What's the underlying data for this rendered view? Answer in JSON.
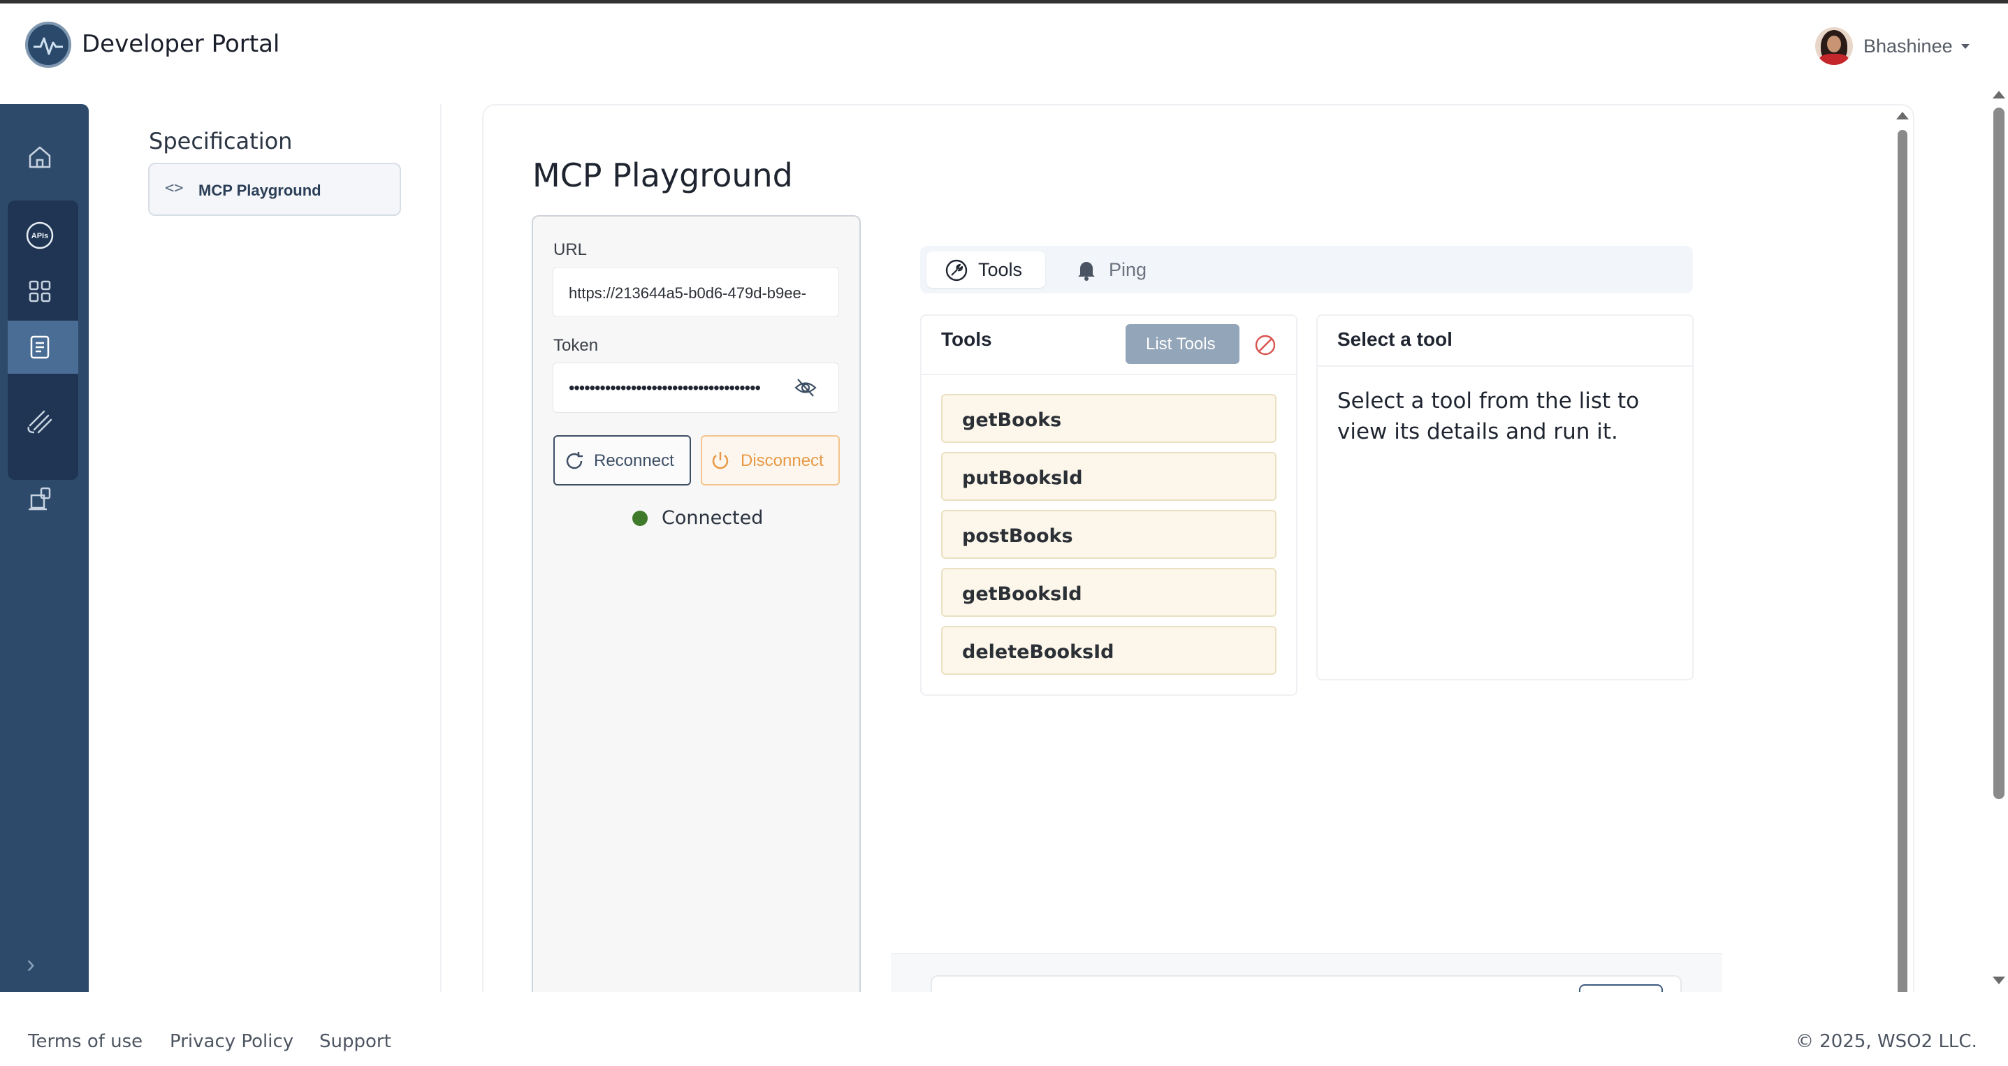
{
  "header": {
    "brand": "Developer Portal",
    "user_name": "Bhashinee"
  },
  "rail": {
    "items": [
      {
        "name": "home-icon"
      },
      {
        "name": "apis-icon",
        "label": "APIs"
      },
      {
        "name": "applications-icon"
      },
      {
        "name": "documentation-icon"
      },
      {
        "name": "sdk-icon"
      },
      {
        "name": "user-settings-icon"
      }
    ]
  },
  "spec_panel": {
    "title": "Specification",
    "item_icon": "<>",
    "item_label": "MCP Playground"
  },
  "main": {
    "title": "MCP Playground",
    "connection": {
      "url_label": "URL",
      "url_value": "https://213644a5-b0d6-479d-b9ee-",
      "token_label": "Token",
      "token_value": "•••••••••••••••••••••••••••••••••••••",
      "reconnect_label": "Reconnect",
      "disconnect_label": "Disconnect",
      "status": "Connected",
      "status_color": "#3e7a29"
    },
    "tabs": [
      {
        "label": "Tools",
        "icon": "wrench-icon",
        "active": true
      },
      {
        "label": "Ping",
        "icon": "bell-icon",
        "active": false
      }
    ],
    "tools": {
      "title": "Tools",
      "list_button": "List Tools",
      "items": [
        "getBooks",
        "putBooksId",
        "postBooks",
        "getBooksId",
        "deleteBooksId"
      ]
    },
    "details": {
      "title": "Select a tool",
      "placeholder": "Select a tool from the list to view its details and run it."
    }
  },
  "footer": {
    "links": [
      "Terms of use",
      "Privacy Policy",
      "Support"
    ],
    "copyright": "© 2025, WSO2 LLC."
  },
  "colors": {
    "rail": "#2e4a6b",
    "accent_orange": "#e79a45",
    "tool_item_bg": "#fcf7ea"
  }
}
